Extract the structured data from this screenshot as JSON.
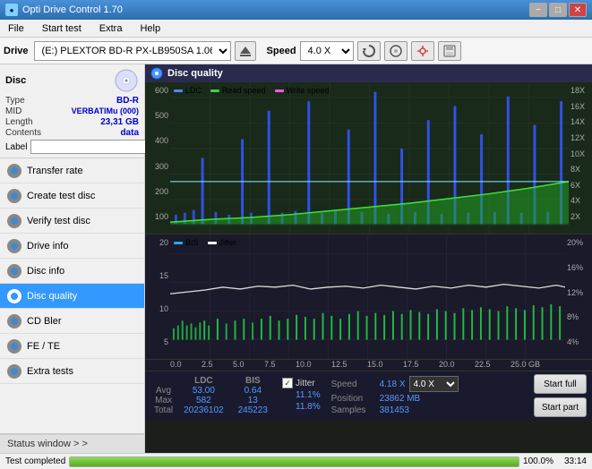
{
  "app": {
    "title": "Opti Drive Control 1.70",
    "icon": "disc-icon"
  },
  "titlebar": {
    "title": "Opti Drive Control 1.70",
    "minimize": "−",
    "maximize": "□",
    "close": "✕"
  },
  "menubar": {
    "items": [
      "File",
      "Start test",
      "Extra",
      "Help"
    ]
  },
  "toolbar": {
    "drive_label": "Drive",
    "drive_value": "(E:)  PLEXTOR BD-R  PX-LB950SA 1.06",
    "speed_label": "Speed",
    "speed_value": "4.0 X"
  },
  "sidebar": {
    "disc_label": "Disc",
    "disc_info": {
      "type_label": "Type",
      "type_value": "BD-R",
      "mid_label": "MID",
      "mid_value": "VERBATIMu (000)",
      "length_label": "Length",
      "length_value": "23,31 GB",
      "contents_label": "Contents",
      "contents_value": "data",
      "label_label": "Label"
    },
    "nav_items": [
      {
        "id": "transfer-rate",
        "label": "Transfer rate",
        "active": false
      },
      {
        "id": "create-test-disc",
        "label": "Create test disc",
        "active": false
      },
      {
        "id": "verify-test-disc",
        "label": "Verify test disc",
        "active": false
      },
      {
        "id": "drive-info",
        "label": "Drive info",
        "active": false
      },
      {
        "id": "disc-info",
        "label": "Disc info",
        "active": false
      },
      {
        "id": "disc-quality",
        "label": "Disc quality",
        "active": true
      },
      {
        "id": "cd-bler",
        "label": "CD Bler",
        "active": false
      },
      {
        "id": "fe-te",
        "label": "FE / TE",
        "active": false
      },
      {
        "id": "extra-tests",
        "label": "Extra tests",
        "active": false
      }
    ],
    "status_window": "Status window > >"
  },
  "chart": {
    "title": "Disc quality",
    "legend": {
      "ldc": "LDC",
      "read_speed": "Read speed",
      "write_speed": "Write speed"
    },
    "legend2": {
      "bis": "BIS",
      "jitter": "Jitter"
    },
    "top_chart": {
      "y_max": 600,
      "y_labels": [
        "600",
        "500",
        "400",
        "300",
        "200",
        "100"
      ],
      "y_right_labels": [
        "18X",
        "16X",
        "14X",
        "12X",
        "10X",
        "8X",
        "6X",
        "4X",
        "2X"
      ],
      "x_labels": [
        "0.0",
        "2.5",
        "5.0",
        "7.5",
        "10.0",
        "12.5",
        "15.0",
        "17.5",
        "20.0",
        "22.5",
        "25.0 GB"
      ]
    },
    "bottom_chart": {
      "y_max": 20,
      "y_labels": [
        "20",
        "15",
        "10",
        "5"
      ],
      "y_right_labels": [
        "20%",
        "16%",
        "12%",
        "8%",
        "4%"
      ],
      "x_labels": [
        "0.0",
        "2.5",
        "5.0",
        "7.5",
        "10.0",
        "12.5",
        "15.0",
        "17.5",
        "20.0",
        "22.5",
        "25.0 GB"
      ]
    }
  },
  "stats": {
    "columns": [
      "LDC",
      "BIS"
    ],
    "jitter_label": "Jitter",
    "jitter_checked": true,
    "rows": [
      {
        "label": "Avg",
        "ldc": "53.00",
        "bis": "0.64",
        "jitter": "11.1%"
      },
      {
        "label": "Max",
        "ldc": "582",
        "bis": "13",
        "jitter": "11.8%"
      },
      {
        "label": "Total",
        "ldc": "20236102",
        "bis": "245223",
        "jitter": ""
      }
    ],
    "speed_label": "Speed",
    "speed_value": "4.18 X",
    "speed_select": "4.0 X",
    "position_label": "Position",
    "position_value": "23862 MB",
    "samples_label": "Samples",
    "samples_value": "381453",
    "btn_start_full": "Start full",
    "btn_start_part": "Start part"
  },
  "statusbar": {
    "status_text": "Test completed",
    "progress_percent": 100,
    "progress_display": "100.0%",
    "time": "33:14"
  }
}
